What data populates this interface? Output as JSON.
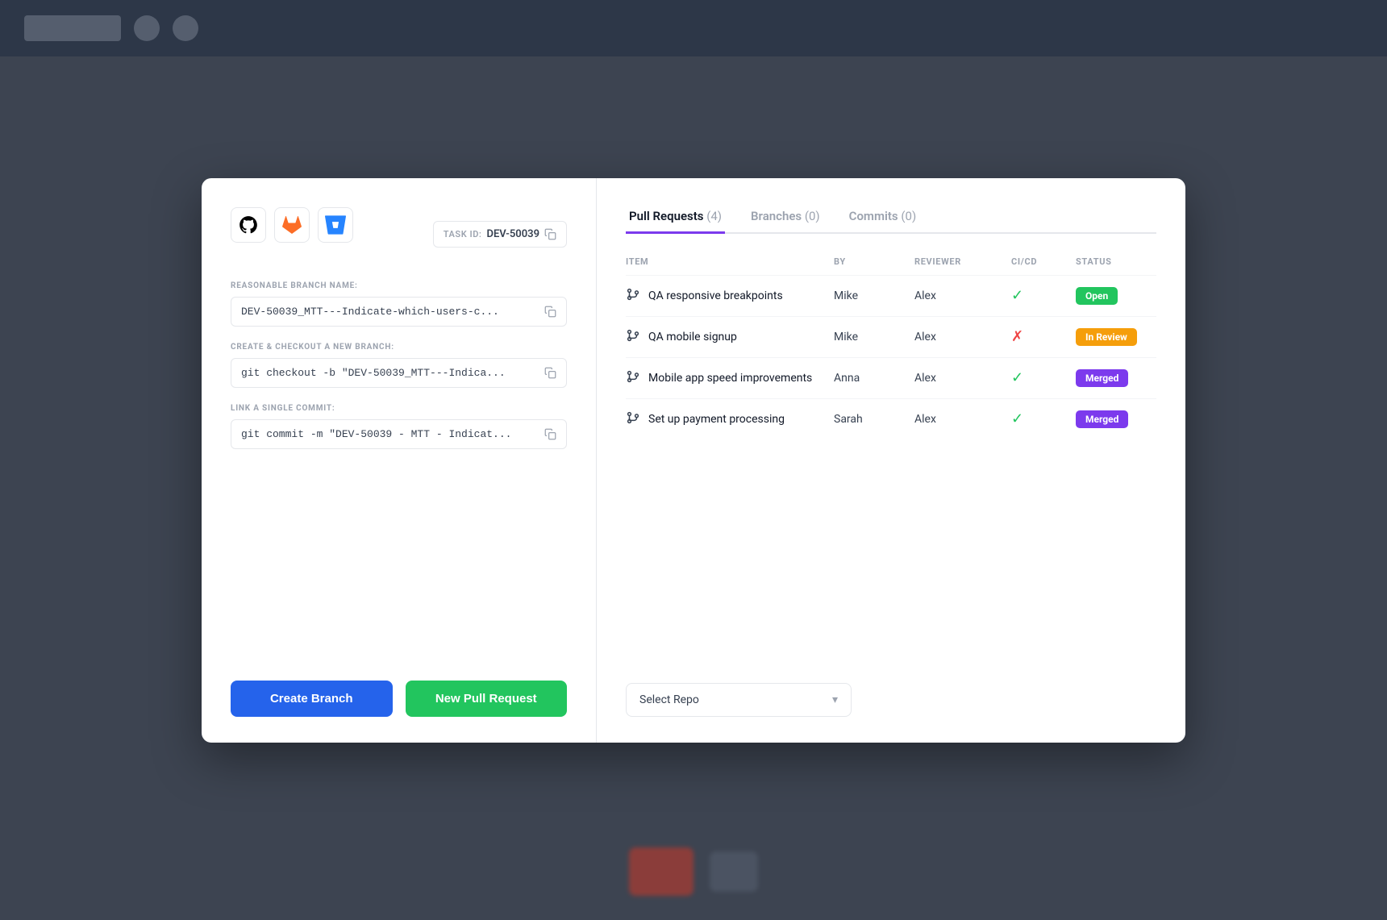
{
  "background": {
    "color": "#3d4451"
  },
  "modal": {
    "left": {
      "providers": [
        {
          "name": "github",
          "icon": "⬛"
        },
        {
          "name": "gitlab",
          "icon": "🦊"
        },
        {
          "name": "bitbucket",
          "icon": "🔷"
        }
      ],
      "task_id_label": "TASK ID:",
      "task_id_value": "DEV-50039",
      "branch_name_label": "REASONABLE BRANCH NAME:",
      "branch_name_value": "DEV-50039_MTT---Indicate-which-users-c...",
      "checkout_label": "CREATE & CHECKOUT A NEW BRANCH:",
      "checkout_value": "git checkout -b \"DEV-50039_MTT---Indica...",
      "commit_label": "LINK A SINGLE COMMIT:",
      "commit_value": "git commit -m \"DEV-50039 - MTT - Indicat...",
      "create_branch_btn": "Create Branch",
      "new_pr_btn": "New Pull Request"
    },
    "right": {
      "tabs": [
        {
          "label": "Pull Requests",
          "count": 4,
          "active": true
        },
        {
          "label": "Branches",
          "count": 0,
          "active": false
        },
        {
          "label": "Commits",
          "count": 0,
          "active": false
        }
      ],
      "table": {
        "columns": [
          "ITEM",
          "BY",
          "REVIEWER",
          "CI/CD",
          "STATUS"
        ],
        "rows": [
          {
            "item": "QA responsive breakpoints",
            "by": "Mike",
            "reviewer": "Alex",
            "ci_pass": true,
            "status": "Open",
            "status_type": "open"
          },
          {
            "item": "QA mobile signup",
            "by": "Mike",
            "reviewer": "Alex",
            "ci_pass": false,
            "status": "In Review",
            "status_type": "review"
          },
          {
            "item": "Mobile app speed improvements",
            "by": "Anna",
            "reviewer": "Alex",
            "ci_pass": true,
            "status": "Merged",
            "status_type": "merged"
          },
          {
            "item": "Set up payment processing",
            "by": "Sarah",
            "reviewer": "Alex",
            "ci_pass": true,
            "status": "Merged",
            "status_type": "merged"
          }
        ]
      },
      "select_repo_placeholder": "Select Repo"
    }
  }
}
